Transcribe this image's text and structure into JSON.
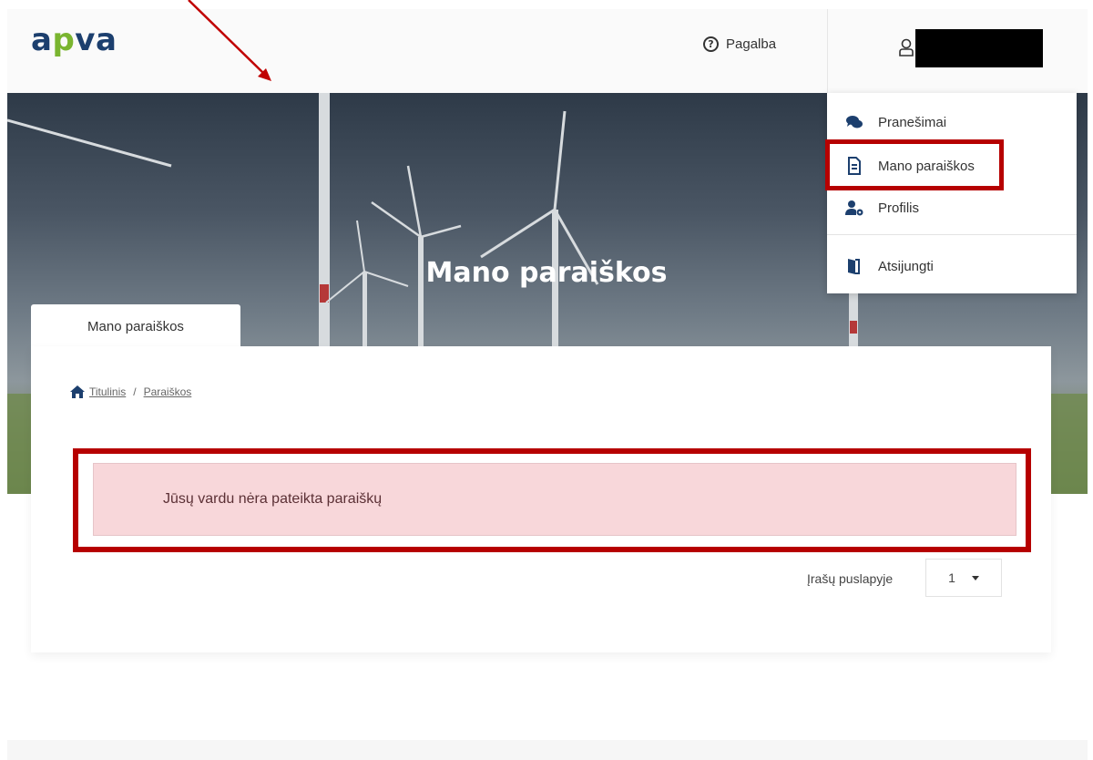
{
  "header": {
    "logo": {
      "pre": "a",
      "accent": "p",
      "post": "va"
    },
    "help_label": "Pagalba",
    "help_icon": "question-circle-icon",
    "user_icon": "user-icon"
  },
  "hero": {
    "title": "Mano paraiškos"
  },
  "user_menu": {
    "items": [
      {
        "label": "Pranešimai",
        "icon": "chat-bubbles-icon"
      },
      {
        "label": "Mano paraiškos",
        "icon": "document-icon"
      },
      {
        "label": "Profilis",
        "icon": "user-settings-icon"
      },
      {
        "label": "Atsijungti",
        "icon": "door-exit-icon"
      }
    ]
  },
  "tab": {
    "label": "Mano paraiškos"
  },
  "breadcrumb": {
    "home": "Titulinis",
    "separator": "/",
    "current": "Paraiškos"
  },
  "alert": {
    "message": "Jūsų vardu nėra pateikta paraiškų"
  },
  "pagination": {
    "per_page_label": "Įrašų puslapyje",
    "per_page_value": "1"
  },
  "colors": {
    "logo_blue": "#1c3f6e",
    "logo_green": "#7ab530",
    "annotation_red": "#b60000",
    "alert_bg": "#f8d7da"
  }
}
